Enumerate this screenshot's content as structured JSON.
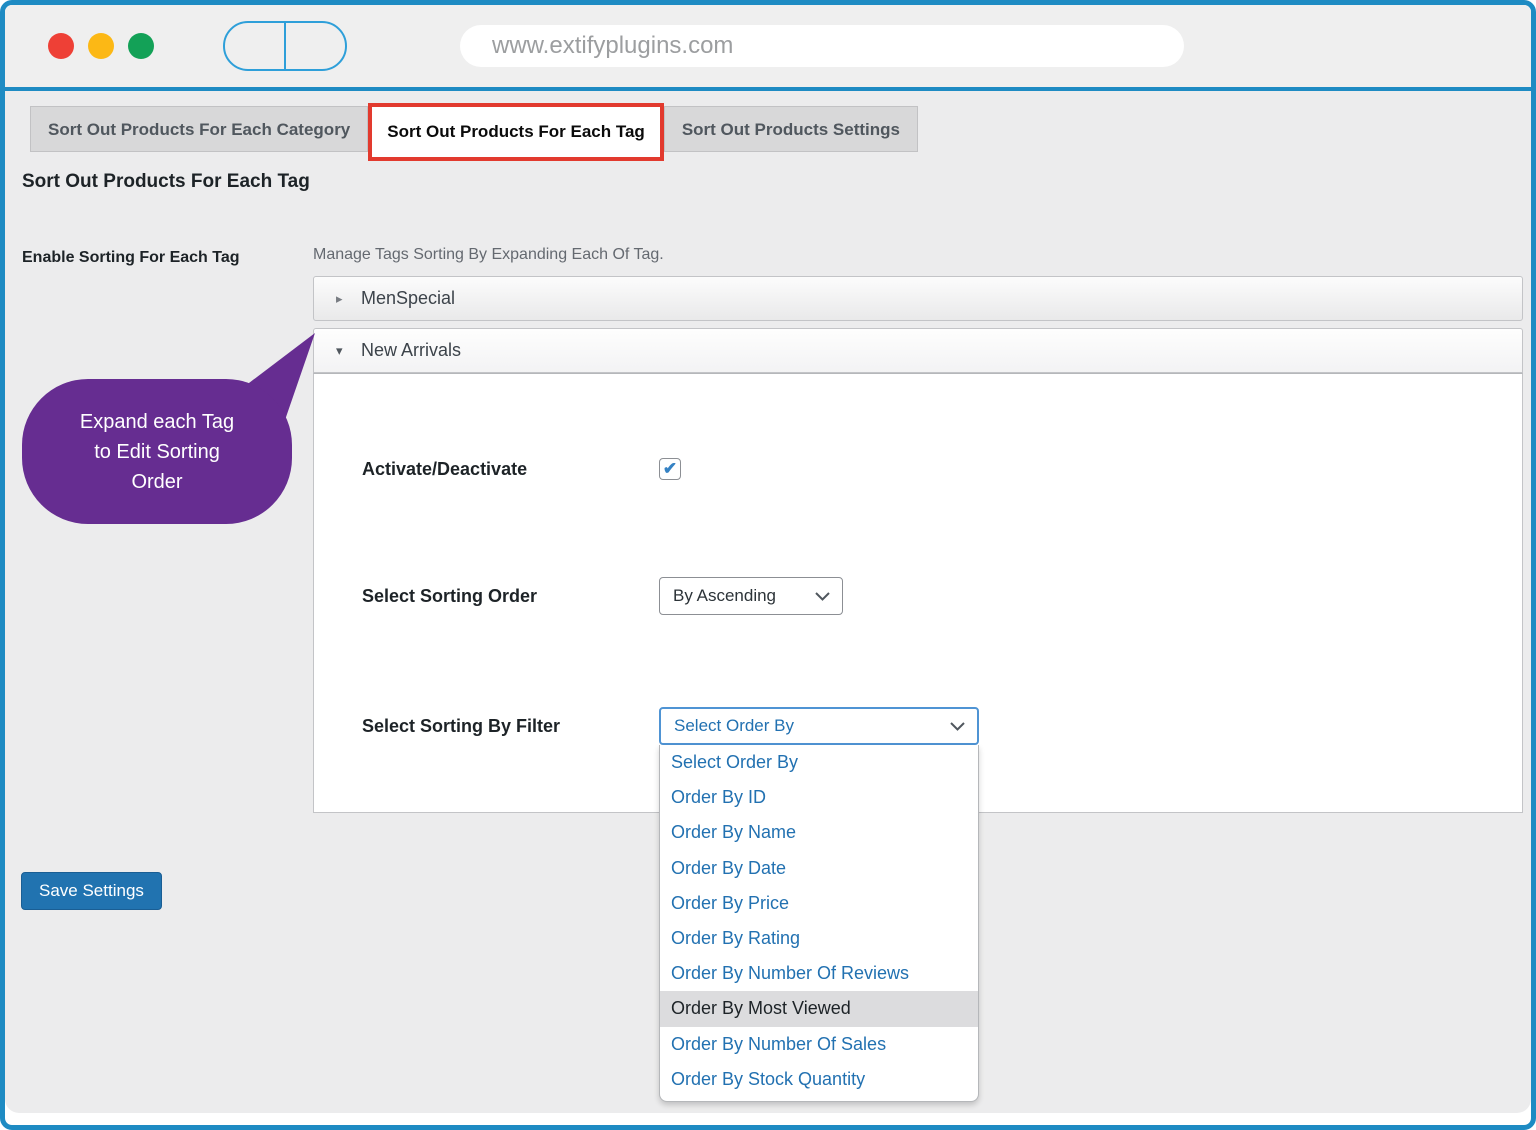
{
  "browser": {
    "url": "www.extifyplugins.com"
  },
  "tabs": [
    {
      "label": "Sort Out Products For Each Category",
      "active": false
    },
    {
      "label": "Sort Out Products For Each Tag",
      "active": true
    },
    {
      "label": "Sort Out Products Settings",
      "active": false
    }
  ],
  "page": {
    "title": "Sort Out Products For Each Tag",
    "setting_label": "Enable Sorting For Each Tag",
    "setting_description": "Manage Tags Sorting By Expanding Each Of Tag."
  },
  "accordion": {
    "collapsed_item": "MenSpecial",
    "expanded_item": "New Arrivals"
  },
  "form": {
    "activate_label": "Activate/Deactivate",
    "activate_checked": true,
    "check_glyph": "✔",
    "sorting_order_label": "Select Sorting Order",
    "sorting_order_value": "By Ascending",
    "filter_label": "Select Sorting By Filter",
    "filter_value": "Select Order By",
    "filter_options": [
      "Select Order By",
      "Order By ID",
      "Order By Name",
      "Order By Date",
      "Order By Price",
      "Order By Rating",
      "Order By Number Of Reviews",
      "Order By Most Viewed",
      "Order By Number Of Sales",
      "Order By Stock Quantity"
    ],
    "filter_highlight_index": 7
  },
  "callout": {
    "line1": "Expand each Tag",
    "line2": "to Edit Sorting",
    "line3": "Order"
  },
  "buttons": {
    "save": "Save Settings"
  },
  "icons": {
    "collapsed_arrow": "▸",
    "expanded_arrow": "▾"
  },
  "colors": {
    "frame_blue": "#1e8bc3",
    "annotation_red": "#e23a2e",
    "callout_purple": "#662d91",
    "primary_button_blue": "#2173b0",
    "option_link_blue": "#2271b1"
  }
}
